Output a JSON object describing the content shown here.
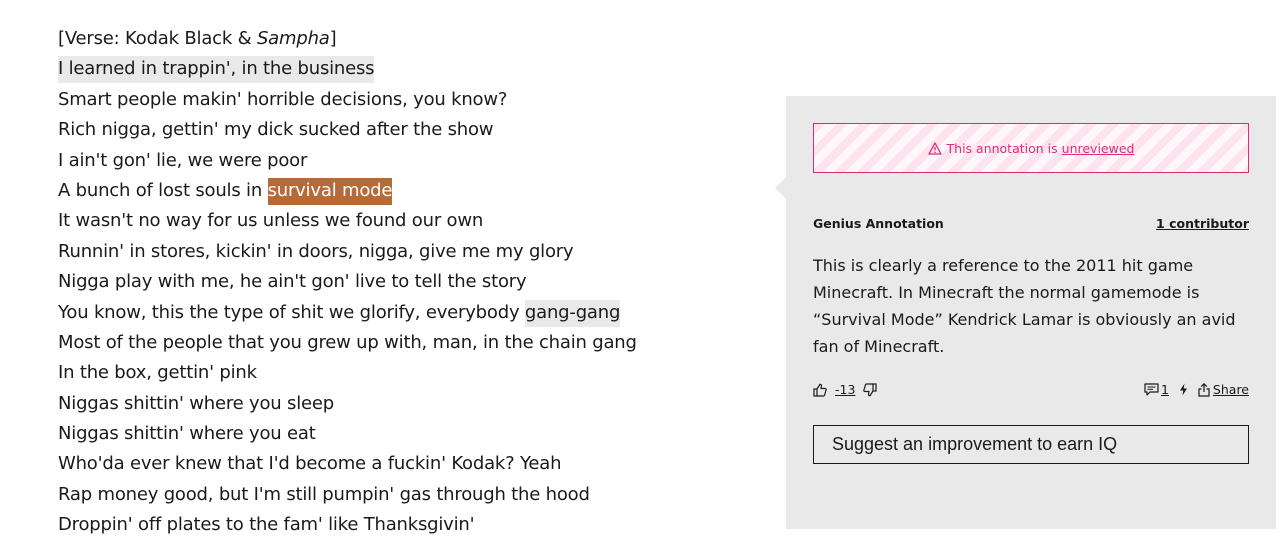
{
  "lyrics": {
    "verse_prefix": "[Verse: Kodak Black & ",
    "verse_italic": "Sampha",
    "verse_suffix": "]",
    "line1": "I learned in trappin', in the business",
    "line2": "Smart people makin' horrible decisions, you know?",
    "line3": "Rich nigga, gettin' my dick sucked after the show",
    "line4": "I ain't gon' lie, we were poor",
    "line5_plain": "A bunch of lost souls in ",
    "line5_highlight": "survival mode",
    "line6": "It wasn't no way for us unless we found our own",
    "line7": "Runnin' in stores, kickin' in doors, nigga, give me my glory",
    "line8": "Nigga play with me, he ain't gon' live to tell the story",
    "line9_plain": "You know, this the type of shit we glorify, everybody ",
    "line9_highlight": "gang-gang",
    "line10": "Most of the people that you grew up with, man, in the chain gang",
    "line11": "In the box, gettin' pink",
    "line12": "Niggas shittin' where you sleep",
    "line13": "Niggas shittin' where you eat",
    "line14": "Who'da ever knew that I'd become a fuckin' Kodak? Yeah",
    "line15": "Rap money good, but I'm still pumpin' gas through the hood",
    "line16": "Droppin' off plates to the fam' like Thanksgivin'"
  },
  "annotation": {
    "unreviewed_text": "This annotation is",
    "unreviewed_link": "unreviewed",
    "header_label": "Genius Annotation",
    "contributors": "1 contributor",
    "body": "This is clearly a reference to the 2011 hit game Minecraft. In Minecraft the normal gamemode is “Survival Mode” Kendrick Lamar is obviously an avid fan of Minecraft.",
    "vote_count": "-13",
    "comment_count": "1",
    "share_label": "Share",
    "suggest_label": "Suggest an improvement to earn IQ"
  },
  "colors": {
    "highlight_active": "#b56b38",
    "highlight_passive": "#e9e9e9",
    "panel_bg": "#e9e9e9",
    "warning_pink": "#e22a79"
  },
  "icons": [
    "warning-icon",
    "thumbs-up-icon",
    "thumbs-down-icon",
    "comment-icon",
    "lightning-icon",
    "share-icon"
  ]
}
